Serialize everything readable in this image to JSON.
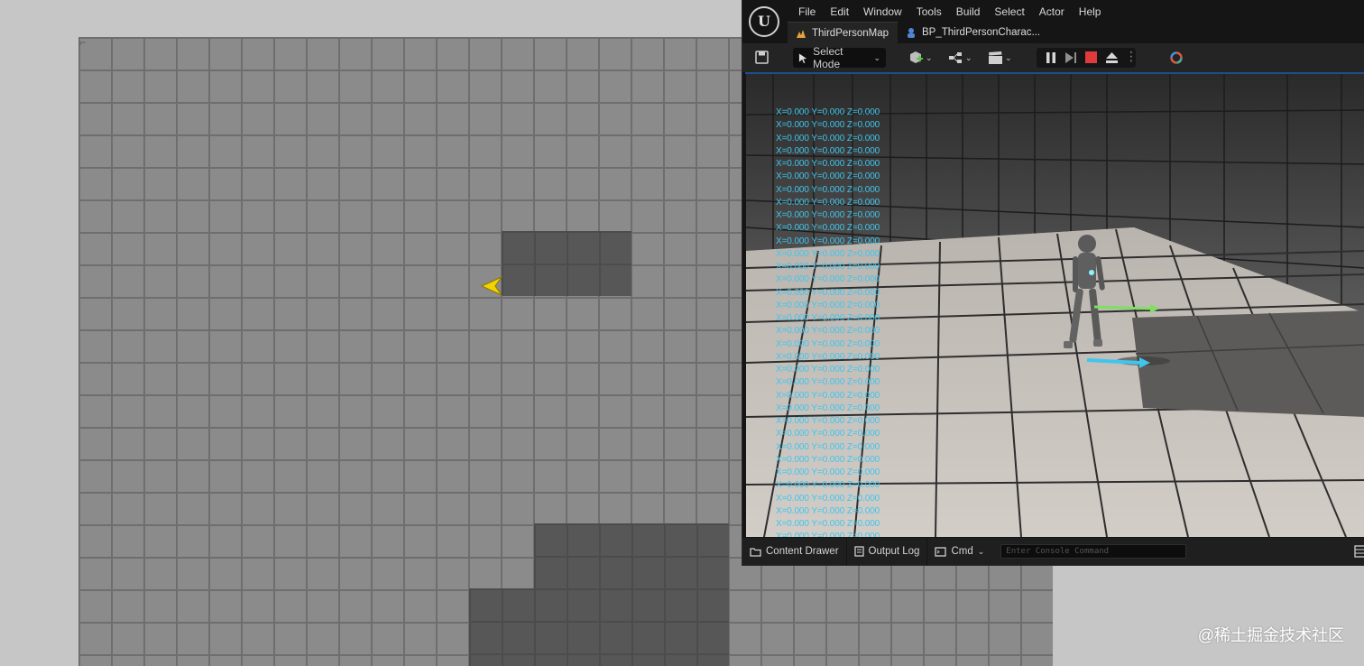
{
  "minimap": {
    "corner_mark": "⌐"
  },
  "watermark": "@稀土掘金技术社区",
  "editor": {
    "menu": [
      "File",
      "Edit",
      "Window",
      "Tools",
      "Build",
      "Select",
      "Actor",
      "Help"
    ],
    "tabs": [
      {
        "label": "ThirdPersonMap",
        "icon": "level-map-icon",
        "active": true
      },
      {
        "label": "BP_ThirdPersonCharac...",
        "icon": "blueprint-icon",
        "active": false
      }
    ],
    "toolbar": {
      "select_mode_label": "Select Mode",
      "stop_color": "#e03b3b"
    },
    "viewport": {
      "coord_text": "X=0.000 Y=0.000 Z=0.000",
      "coord_lines": 34,
      "accent_cyan": "#3ec6ee",
      "accent_green": "#7ee060"
    },
    "bottombar": {
      "content_drawer": "Content Drawer",
      "output_log": "Output Log",
      "cmd": "Cmd",
      "console_placeholder": "Enter Console Command"
    }
  }
}
